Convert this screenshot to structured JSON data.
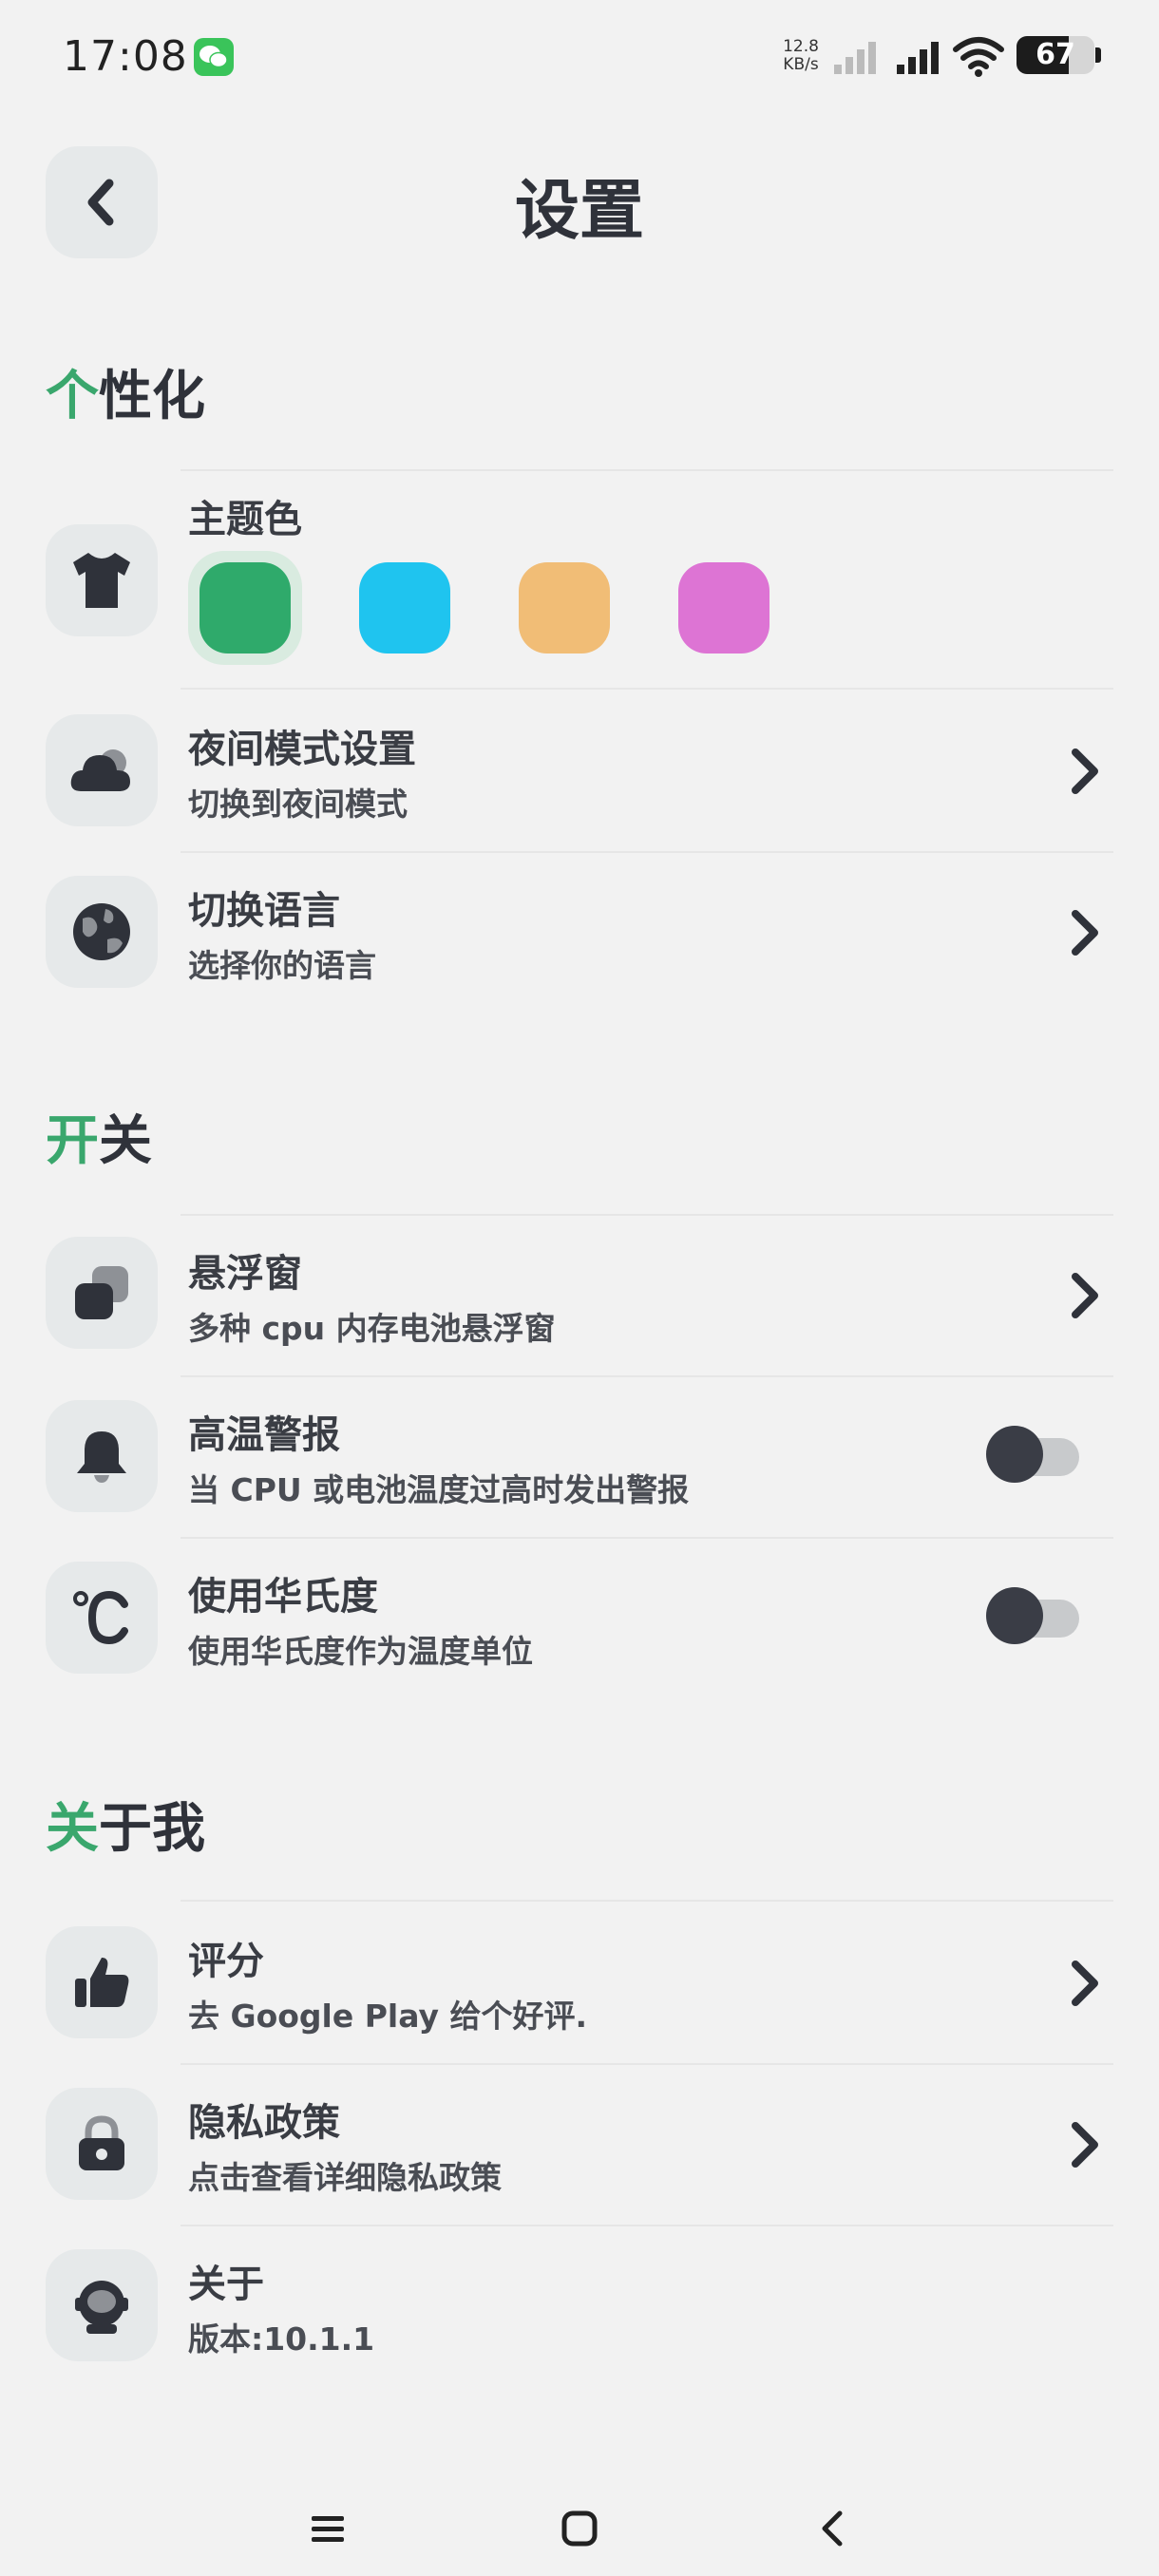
{
  "status_bar": {
    "time": "17:08",
    "net_speed_value": "12.8",
    "net_speed_unit": "KB/s",
    "battery_level": "67",
    "icons": [
      "wechat-icon",
      "signal-icon",
      "wifi-icon",
      "battery-icon"
    ]
  },
  "header": {
    "title": "设置",
    "back_icon": "chevron-left-icon"
  },
  "sections": {
    "personalization": {
      "accent": "个",
      "rest": "性化",
      "theme_color": {
        "title": "主题色",
        "icon": "tshirt-icon",
        "swatches": [
          "#2faa6b",
          "#1fc4ef",
          "#f1bd76",
          "#dd74d4"
        ],
        "selected_index": 0
      },
      "night_mode": {
        "title": "夜间模式设置",
        "subtitle": "切换到夜间模式",
        "icon": "night-cloud-icon"
      },
      "language": {
        "title": "切换语言",
        "subtitle": "选择你的语言",
        "icon": "globe-icon"
      }
    },
    "switches": {
      "accent": "开",
      "rest": "关",
      "floating_window": {
        "title": "悬浮窗",
        "subtitle": "多种 cpu 内存电池悬浮窗",
        "icon": "layers-icon"
      },
      "high_temp_alert": {
        "title": "高温警报",
        "subtitle": "当 CPU 或电池温度过高时发出警报",
        "icon": "bell-icon",
        "enabled": false
      },
      "fahrenheit": {
        "title": "使用华氏度",
        "subtitle": "使用华氏度作为温度单位",
        "icon": "celsius-icon",
        "enabled": false
      }
    },
    "about_me": {
      "accent": "关",
      "rest": "于我",
      "rating": {
        "title": "评分",
        "subtitle": "去 Google Play 给个好评.",
        "icon": "thumbs-up-icon"
      },
      "privacy": {
        "title": "隐私政策",
        "subtitle": "点击查看详细隐私政策",
        "icon": "lock-icon"
      },
      "about": {
        "title": "关于",
        "subtitle": "版本:10.1.1",
        "icon": "astronaut-icon"
      }
    }
  },
  "colors": {
    "accent_green": "#3aa76d",
    "text_dark": "#2f323a",
    "icon_bg": "#e6e9ea",
    "background": "#f2f2f2"
  },
  "nav_bar": {
    "icons": [
      "menu-icon",
      "home-icon",
      "back-icon"
    ]
  }
}
